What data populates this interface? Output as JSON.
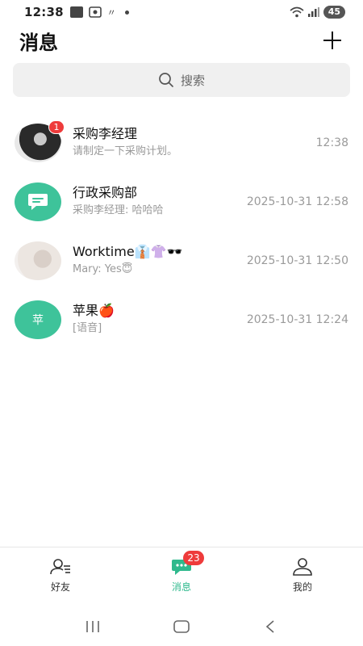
{
  "status_bar": {
    "time": "12:38",
    "battery": "45"
  },
  "header": {
    "title": "消息",
    "add_icon": "plus-icon"
  },
  "search": {
    "placeholder": "搜索",
    "icon": "search-icon"
  },
  "conversations": [
    {
      "name": "采购李经理",
      "preview": "请制定一下采购计划。",
      "time": "12:38",
      "badge": "1",
      "avatar_type": "photo"
    },
    {
      "name": "行政采购部",
      "preview": "采购李经理: 哈哈哈",
      "time": "2025-10-31 12:58",
      "avatar_type": "chat-bubble-icon",
      "avatar_color": "#3ec39a"
    },
    {
      "name": "Worktime👔👚🕶️",
      "preview": "Mary: Yes😇",
      "time": "2025-10-31 12:50",
      "avatar_type": "photo"
    },
    {
      "name": "苹果🍎",
      "preview": "[语音]",
      "time": "2025-10-31 12:24",
      "avatar_text": "苹",
      "avatar_color": "#3ec39a"
    }
  ],
  "tabs": [
    {
      "label": "好友",
      "icon": "contacts-icon",
      "active": false
    },
    {
      "label": "消息",
      "icon": "message-icon",
      "active": true,
      "badge": "23"
    },
    {
      "label": "我的",
      "icon": "profile-icon",
      "active": false
    }
  ],
  "colors": {
    "accent": "#2fb98d",
    "badge": "#ee3b3b",
    "avatar_green": "#3ec39a"
  }
}
